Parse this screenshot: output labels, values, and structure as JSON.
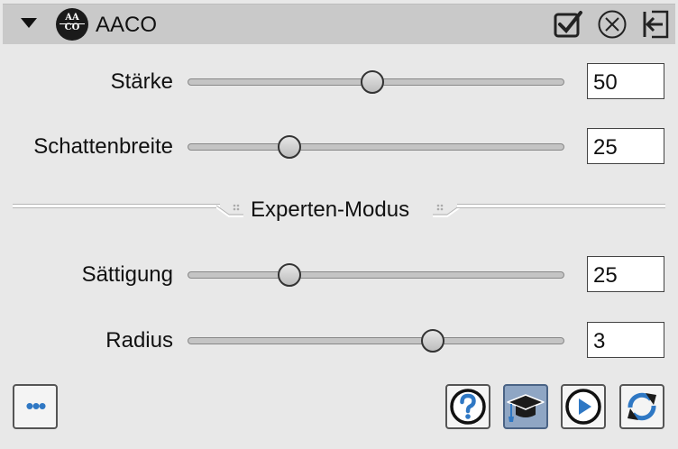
{
  "header": {
    "title": "AACO",
    "logo_top": "AA",
    "logo_bottom": "CO",
    "icons": [
      "collapse-triangle-icon",
      "checkbox-checked-icon",
      "close-circle-icon",
      "exit-arrow-icon"
    ]
  },
  "sliders": [
    {
      "label": "Stärke",
      "value": "50",
      "level": 0.49
    },
    {
      "label": "Schattenbreite",
      "value": "25",
      "level": 0.27
    },
    {
      "label": "Sättigung",
      "value": "25",
      "level": 0.27
    },
    {
      "label": "Radius",
      "value": "3",
      "level": 0.65
    }
  ],
  "section": {
    "label": "Experten-Modus"
  },
  "toolbar": {
    "more_label": "•••",
    "buttons": [
      "help-icon",
      "graduation-cap-icon",
      "play-icon",
      "refresh-icon"
    ]
  },
  "colors": {
    "accent": "#2f78c4",
    "header_bg": "#c9c9c9",
    "panel_bg": "#e8e8e8"
  }
}
